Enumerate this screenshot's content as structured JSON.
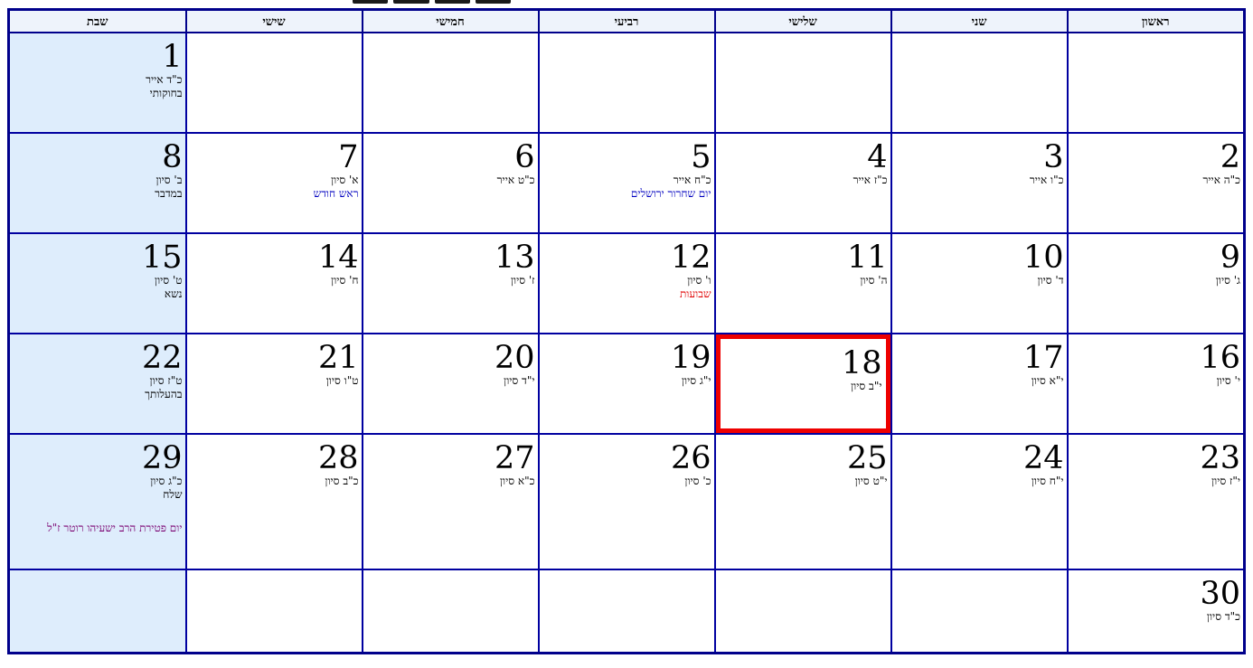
{
  "weekdays": [
    "ראשון",
    "שני",
    "שלישי",
    "רביעי",
    "חמישי",
    "שישי",
    "שבת"
  ],
  "weeks": [
    [
      {
        "day": "",
        "heb": "",
        "parsha": "",
        "events": []
      },
      {
        "day": "",
        "heb": "",
        "parsha": "",
        "events": []
      },
      {
        "day": "",
        "heb": "",
        "parsha": "",
        "events": []
      },
      {
        "day": "",
        "heb": "",
        "parsha": "",
        "events": []
      },
      {
        "day": "",
        "heb": "",
        "parsha": "",
        "events": []
      },
      {
        "day": "",
        "heb": "",
        "parsha": "",
        "events": []
      },
      {
        "day": "1",
        "heb": "כ\"ד אייר",
        "parsha": "בחוקותי",
        "events": []
      }
    ],
    [
      {
        "day": "2",
        "heb": "כ\"ה אייר",
        "parsha": "",
        "events": []
      },
      {
        "day": "3",
        "heb": "כ\"ו אייר",
        "parsha": "",
        "events": []
      },
      {
        "day": "4",
        "heb": "כ\"ז אייר",
        "parsha": "",
        "events": []
      },
      {
        "day": "5",
        "heb": "כ\"ח אייר",
        "parsha": "",
        "events": [
          {
            "text": "יום שחרור ירושלים",
            "color": "blue"
          }
        ]
      },
      {
        "day": "6",
        "heb": "כ\"ט אייר",
        "parsha": "",
        "events": []
      },
      {
        "day": "7",
        "heb": "א' סיון",
        "parsha": "",
        "events": [
          {
            "text": "ראש חודש",
            "color": "blue"
          }
        ]
      },
      {
        "day": "8",
        "heb": "ב' סיון",
        "parsha": "במדבר",
        "events": []
      }
    ],
    [
      {
        "day": "9",
        "heb": "ג' סיון",
        "parsha": "",
        "events": []
      },
      {
        "day": "10",
        "heb": "ד' סיון",
        "parsha": "",
        "events": []
      },
      {
        "day": "11",
        "heb": "ה' סיון",
        "parsha": "",
        "events": []
      },
      {
        "day": "12",
        "heb": "ו' סיון",
        "parsha": "",
        "events": [
          {
            "text": "שבועות",
            "color": "red"
          }
        ]
      },
      {
        "day": "13",
        "heb": "ז' סיון",
        "parsha": "",
        "events": []
      },
      {
        "day": "14",
        "heb": "ח' סיון",
        "parsha": "",
        "events": []
      },
      {
        "day": "15",
        "heb": "ט' סיון",
        "parsha": "נשא",
        "events": []
      }
    ],
    [
      {
        "day": "16",
        "heb": "י' סיון",
        "parsha": "",
        "events": []
      },
      {
        "day": "17",
        "heb": "י\"א סיון",
        "parsha": "",
        "events": []
      },
      {
        "day": "18",
        "heb": "י\"ב סיון",
        "parsha": "",
        "events": [],
        "today": true
      },
      {
        "day": "19",
        "heb": "י\"ג סיון",
        "parsha": "",
        "events": []
      },
      {
        "day": "20",
        "heb": "י\"ד סיון",
        "parsha": "",
        "events": []
      },
      {
        "day": "21",
        "heb": "ט\"ו סיון",
        "parsha": "",
        "events": []
      },
      {
        "day": "22",
        "heb": "ט\"ז סיון",
        "parsha": "בהעלותך",
        "events": []
      }
    ],
    [
      {
        "day": "23",
        "heb": "י\"ז סיון",
        "parsha": "",
        "events": []
      },
      {
        "day": "24",
        "heb": "י\"ח סיון",
        "parsha": "",
        "events": []
      },
      {
        "day": "25",
        "heb": "י\"ט סיון",
        "parsha": "",
        "events": []
      },
      {
        "day": "26",
        "heb": "כ' סיון",
        "parsha": "",
        "events": []
      },
      {
        "day": "27",
        "heb": "כ\"א סיון",
        "parsha": "",
        "events": []
      },
      {
        "day": "28",
        "heb": "כ\"ב סיון",
        "parsha": "",
        "events": []
      },
      {
        "day": "29",
        "heb": "כ\"ג סיון",
        "parsha": "שלח",
        "events": [
          {
            "text": "יום פטירת הרב ישעיהו רוטר ז\"ל",
            "color": "purple"
          }
        ]
      }
    ],
    [
      {
        "day": "30",
        "heb": "כ\"ד סיון",
        "parsha": "",
        "events": []
      },
      {
        "day": "",
        "heb": "",
        "parsha": "",
        "events": []
      },
      {
        "day": "",
        "heb": "",
        "parsha": "",
        "events": []
      },
      {
        "day": "",
        "heb": "",
        "parsha": "",
        "events": []
      },
      {
        "day": "",
        "heb": "",
        "parsha": "",
        "events": []
      },
      {
        "day": "",
        "heb": "",
        "parsha": "",
        "events": []
      },
      {
        "day": "",
        "heb": "",
        "parsha": "",
        "events": []
      }
    ]
  ]
}
